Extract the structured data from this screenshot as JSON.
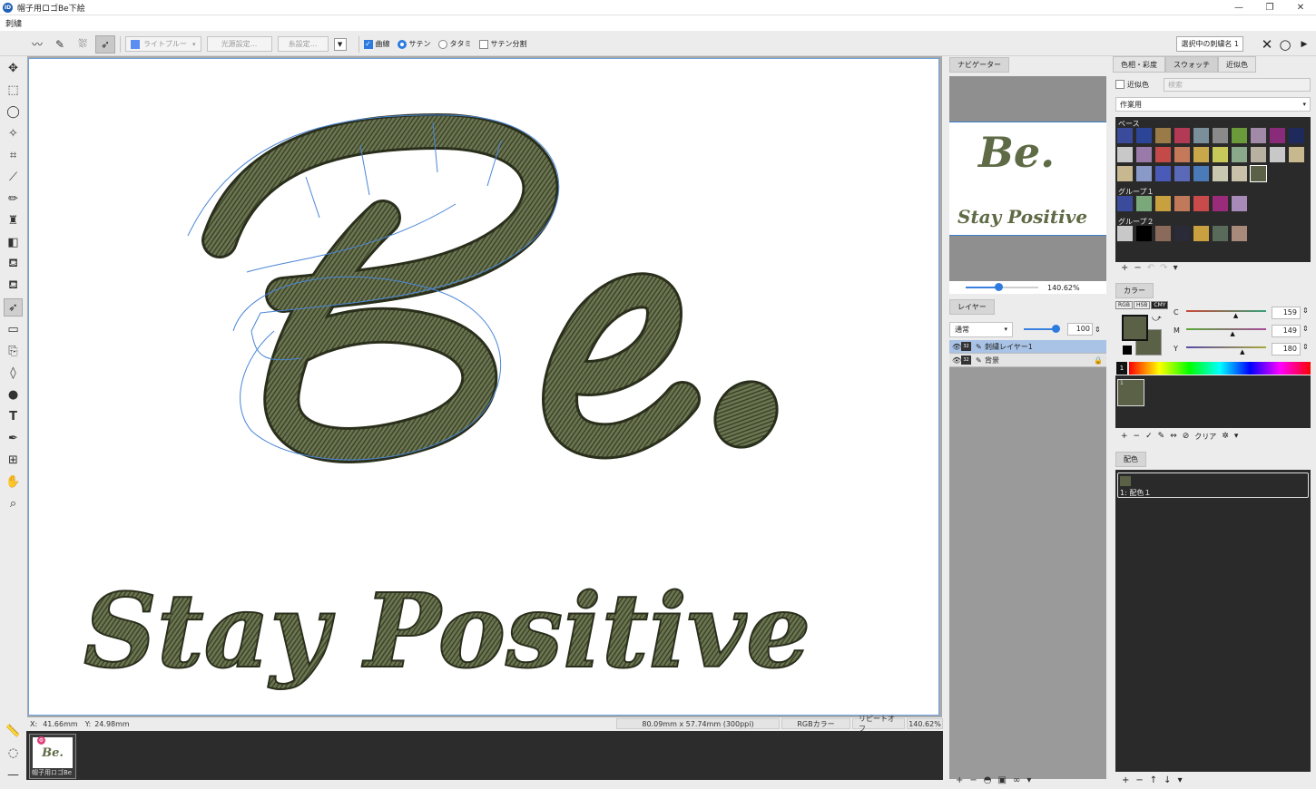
{
  "window": {
    "title": "帽子用ロゴBe下絵",
    "controls": [
      "—",
      "❐",
      "✕"
    ]
  },
  "menu": {
    "item": "刺繍"
  },
  "toolbar": {
    "color_name": "ライトブルー",
    "light_settings": "光源設定...",
    "thread_settings": "糸設定...",
    "curve_label": "曲線",
    "satin_label": "サテン",
    "tatami_label": "タタミ",
    "satin_split_label": "サテン分割",
    "selected_name": "選択中の刺繍名 1"
  },
  "canvas": {
    "big_text": "Be.",
    "sub_text": "Stay Positive",
    "thread_color": "#5f6b46"
  },
  "status": {
    "x_label": "X:",
    "x": "41.66mm",
    "y_label": "Y:",
    "y": "24.98mm",
    "size": "80.09mm x 57.74mm (300ppi)",
    "color_mode": "RGBカラー",
    "repeat": "リピートオフ",
    "zoom": "140.62%"
  },
  "thumb": {
    "label": "帽子用ロゴBe",
    "badge": "⚙",
    "text": "Be."
  },
  "navigator": {
    "tab": "ナビゲーター",
    "zoom": "140.62%",
    "preview_big": "Be.",
    "preview_small": "Stay Positive",
    "zoom_fraction": 0.45
  },
  "layers": {
    "tab": "レイヤー",
    "blend": "通常",
    "opacity": "100",
    "items": [
      {
        "name": "刺繍レイヤー1",
        "depth": "32"
      },
      {
        "name": "背景",
        "depth": "32"
      }
    ]
  },
  "swatches": {
    "tabs": [
      "色相・彩度",
      "スウォッチ",
      "近似色"
    ],
    "near_label": "近似色",
    "search_placeholder": "検索",
    "set": "作業用",
    "groups": [
      {
        "name": "ベース",
        "rows": [
          [
            "#3a4b9c",
            "#2c4597",
            "#9a7b48",
            "#b23a55",
            "#7a8f9a",
            "#8a8a8a",
            "#6a9a3a",
            "#a08aa8",
            "#8a2a7a",
            "#1f2a5c"
          ],
          [
            "#c8c8c8",
            "#9a7aa8",
            "#c44a4a",
            "#c47a5a",
            "#c8a84a",
            "#c8c85a",
            "#8aa88a",
            "#b8b0a0",
            "#c8c8c8",
            "#c8b890"
          ],
          [
            "#c8b890",
            "#8a9ac8",
            "#4a5ab8",
            "#5a6ab8",
            "#4a7ab8",
            "#c8c8b0",
            "#c8c0a8",
            "#5a6147"
          ]
        ]
      },
      {
        "name": "グループ１",
        "rows": [
          [
            "#3a4b9c",
            "#7aa87a",
            "#c8a040",
            "#c07a5a",
            "#c84a4a",
            "#9a2a7a",
            "#a88ab8"
          ]
        ]
      },
      {
        "name": "グループ２",
        "rows": [
          [
            "#c8c8c8",
            "#000000",
            "#8a6a5a",
            "#2a2a38",
            "#c8a040",
            "#5a6a5a",
            "#a88a7a"
          ]
        ]
      }
    ]
  },
  "color": {
    "tab": "カラー",
    "modes": [
      "RGB",
      "HSB",
      "CMY"
    ],
    "sliders": [
      {
        "label": "C",
        "value": "159"
      },
      {
        "label": "M",
        "value": "149"
      },
      {
        "label": "Y",
        "value": "180"
      }
    ],
    "current": "#5a6147",
    "spectrum_num": "1",
    "clear_label": "クリア",
    "slot": "1"
  },
  "scheme": {
    "tab": "配色",
    "item": "1: 配色１"
  }
}
